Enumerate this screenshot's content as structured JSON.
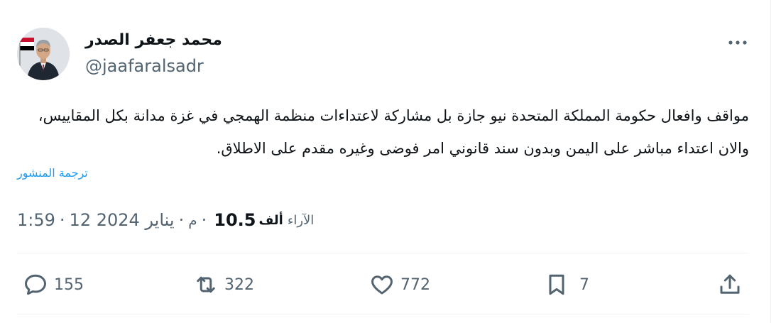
{
  "author": {
    "display_name": "محمد جعفر الصدر",
    "handle": "@jaafaralsadr"
  },
  "tweet": {
    "text": "مواقف وافعال حكومة المملكة المتحدة نيو جازة بل مشاركة لاعتداءات منظمة الهمجي في غزة مدانة بكل المقاييس، والان اعتداء مباشر على اليمن وبدون سند قانوني امر فوضى وغيره مقدم على الاطلاق.",
    "translate_label": "ترجمة المنشور"
  },
  "meta": {
    "time": "1:59",
    "ampm": "م",
    "date": "12 يناير 2024",
    "separator": "·",
    "views_number": "10.5",
    "views_unit": "ألف",
    "views_label": "الآراء"
  },
  "actions": {
    "replies": "155",
    "reposts": "322",
    "likes": "772",
    "bookmarks": "7"
  },
  "icons": {
    "more": "more-horizontal-icon",
    "reply": "reply-icon",
    "repost": "repost-icon",
    "like": "heart-icon",
    "bookmark": "bookmark-icon",
    "share": "share-icon"
  }
}
